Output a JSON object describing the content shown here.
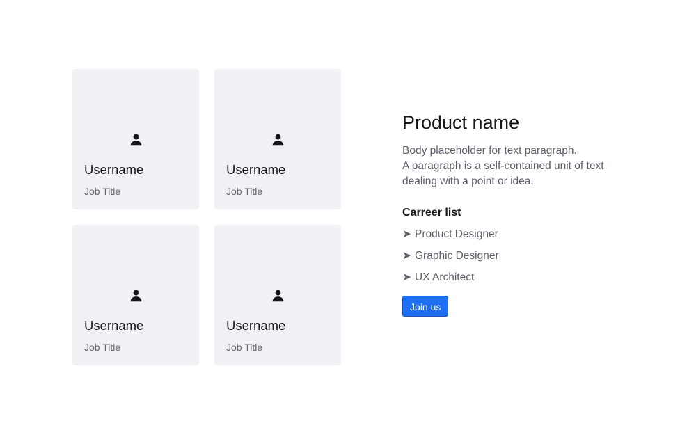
{
  "cards": [
    {
      "username": "Username",
      "job_title": "Job Title",
      "icon": "user-icon"
    },
    {
      "username": "Username",
      "job_title": "Job Title",
      "icon": "user-icon"
    },
    {
      "username": "Username",
      "job_title": "Job Title",
      "icon": "user-icon"
    },
    {
      "username": "Username",
      "job_title": "Job Title",
      "icon": "user-icon"
    }
  ],
  "product": {
    "title": "Product name",
    "body_line_1": "Body placeholder for text paragraph.",
    "body_line_2": "A paragraph is a self-contained unit of text",
    "body_line_3": "dealing with a point or idea."
  },
  "career": {
    "heading": "Carreer list",
    "bullet": "➤",
    "items": [
      "Product Designer",
      "Graphic Designer",
      "UX Architect"
    ]
  },
  "cta": {
    "label": "Join us",
    "color": "#1f6ff5"
  },
  "colors": {
    "card_background": "#f0f1f5",
    "text_primary": "#15171a",
    "text_secondary": "#5a5f69"
  }
}
